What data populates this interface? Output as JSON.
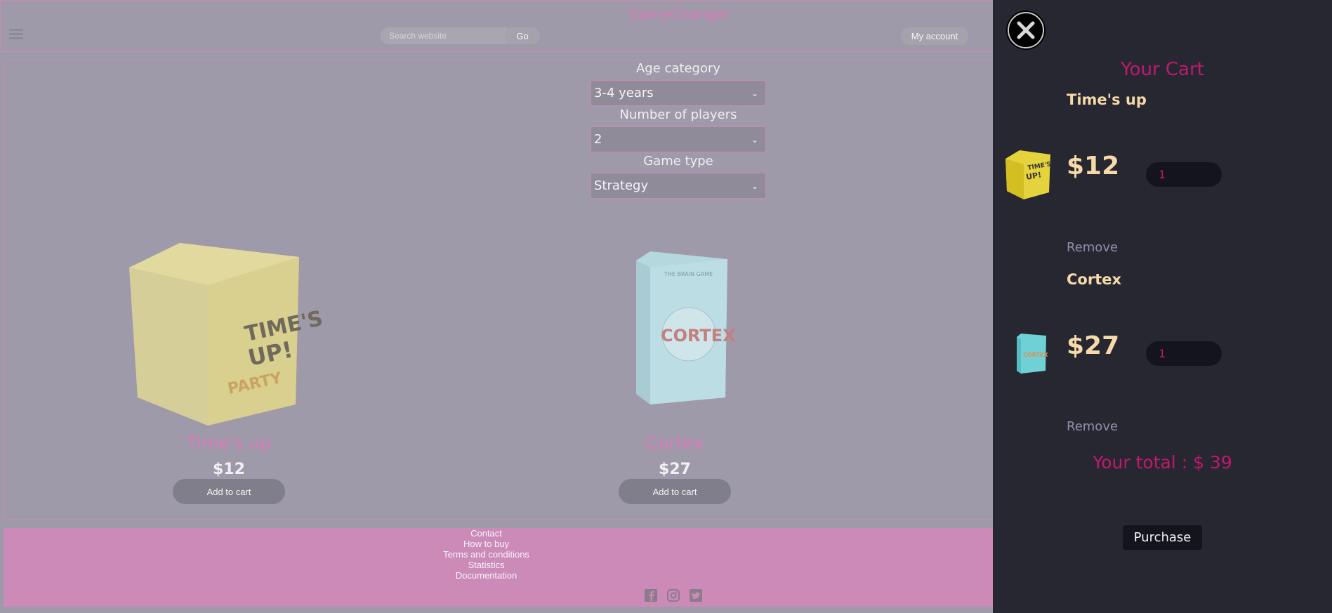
{
  "header": {
    "brand": "GameChanger",
    "search_placeholder": "Search website",
    "go_label": "Go",
    "account_label": "My account",
    "menu_icon": "hamburger-icon"
  },
  "filters": [
    {
      "label": "Age category",
      "selected": "3-4 years"
    },
    {
      "label": "Number of players",
      "selected": "2"
    },
    {
      "label": "Game type",
      "selected": "Strategy"
    }
  ],
  "products": [
    {
      "name": "Time's up",
      "price": "$12",
      "button": "Add to cart"
    },
    {
      "name": "Cortex",
      "price": "$27",
      "button": "Add to cart"
    }
  ],
  "footer": {
    "links": [
      "Contact",
      "How to buy",
      "Terms and conditions",
      "Statistics",
      "Documentation"
    ],
    "social_icons": [
      "facebook-icon",
      "instagram-icon",
      "twitter-icon"
    ]
  },
  "cart": {
    "title": "Your Cart",
    "close_icon": "close-icon",
    "items": [
      {
        "name": "Time's up",
        "price": "$12",
        "quantity": "1",
        "remove_label": "Remove"
      },
      {
        "name": "Cortex",
        "price": "$27",
        "quantity": "1",
        "remove_label": "Remove"
      }
    ],
    "total_text": "Your total : $ 39",
    "purchase_label": "Purchase"
  },
  "colors": {
    "brand_pink": "#d879b8",
    "cart_bg": "#272732",
    "cart_accent": "#c0196f",
    "cart_text": "#f5d9a8",
    "footer_bg": "#cb8ab8"
  }
}
